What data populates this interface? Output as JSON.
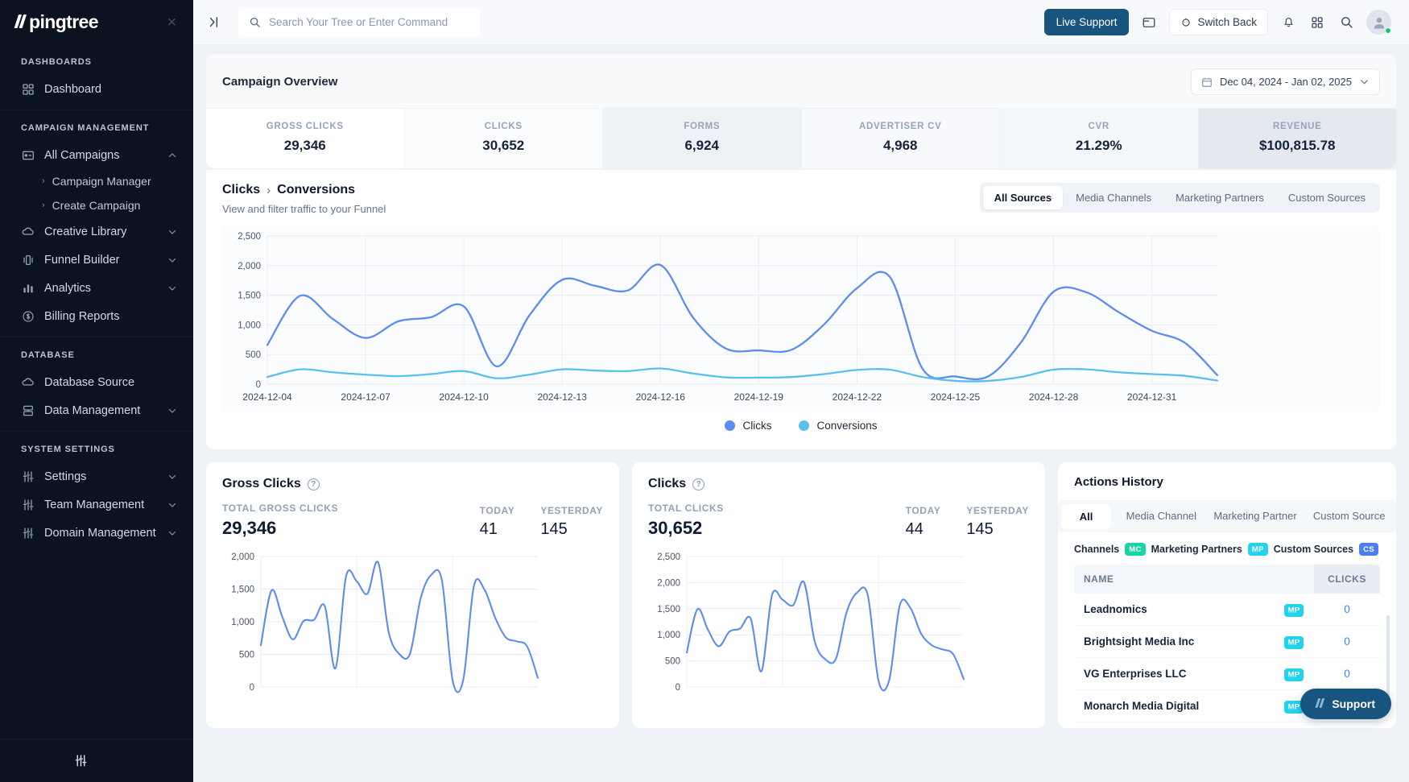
{
  "sidebar": {
    "logo": "pingtree",
    "close_icon": "close-icon",
    "sections": [
      {
        "label": "DASHBOARDS",
        "items": [
          {
            "label": "Dashboard",
            "icon": "grid-icon",
            "chevron": "",
            "subitems": []
          }
        ]
      },
      {
        "label": "CAMPAIGN MANAGEMENT",
        "items": [
          {
            "label": "All Campaigns",
            "icon": "campaign-icon",
            "chevron": "⌃",
            "subitems": [
              "Campaign Manager",
              "Create Campaign"
            ]
          },
          {
            "label": "Creative Library",
            "icon": "cloud-icon",
            "chevron": "⌄",
            "subitems": []
          },
          {
            "label": "Funnel Builder",
            "icon": "funnel-icon",
            "chevron": "⌄",
            "subitems": []
          },
          {
            "label": "Analytics",
            "icon": "bar-chart-icon",
            "chevron": "⌄",
            "subitems": []
          },
          {
            "label": "Billing Reports",
            "icon": "dollar-icon",
            "chevron": "",
            "subitems": []
          }
        ]
      },
      {
        "label": "DATABASE",
        "items": [
          {
            "label": "Database Source",
            "icon": "cloud-icon",
            "chevron": "",
            "subitems": []
          },
          {
            "label": "Data Management",
            "icon": "server-icon",
            "chevron": "⌄",
            "subitems": []
          }
        ]
      },
      {
        "label": "SYSTEM SETTINGS",
        "items": [
          {
            "label": "Settings",
            "icon": "sliders-icon",
            "chevron": "⌄",
            "subitems": []
          },
          {
            "label": "Team Management",
            "icon": "sliders-icon",
            "chevron": "⌄",
            "subitems": []
          },
          {
            "label": "Domain Management",
            "icon": "sliders-icon",
            "chevron": "⌄",
            "subitems": []
          }
        ]
      }
    ],
    "footer_icon": "sliders-icon"
  },
  "topbar": {
    "collapse_icon": "collapse-panel-icon",
    "search_placeholder": "Search Your Tree or Enter Command",
    "search_value": "",
    "live_support_label": "Live Support",
    "folder_icon": "folder-icon",
    "switch_back_label": "Switch Back",
    "bell_icon": "bell-icon",
    "apps_icon": "apps-grid-icon",
    "search_icon": "search-icon",
    "avatar_icon": "avatar"
  },
  "overview": {
    "title": "Campaign Overview",
    "date_range": "Dec 04, 2024 - Jan 02, 2025",
    "calendar_icon": "calendar-icon",
    "chevron_icon": "chevron-down-icon",
    "metrics": [
      {
        "label": "GROSS CLICKS",
        "value": "29,346"
      },
      {
        "label": "CLICKS",
        "value": "30,652"
      },
      {
        "label": "FORMS",
        "value": "6,924"
      },
      {
        "label": "ADVERTISER CV",
        "value": "4,968"
      },
      {
        "label": "CVR",
        "value": "21.29%"
      },
      {
        "label": "REVENUE",
        "value": "$100,815.78"
      }
    ]
  },
  "funnel": {
    "breadcrumb_first": "Clicks",
    "breadcrumb_sep": "›",
    "breadcrumb_second": "Conversions",
    "subtitle": "View and filter traffic to your Funnel",
    "tabs": [
      {
        "label": "All Sources",
        "active": true
      },
      {
        "label": "Media Channels",
        "active": false
      },
      {
        "label": "Marketing Partners",
        "active": false
      },
      {
        "label": "Custom Sources",
        "active": false
      }
    ]
  },
  "chart_data": [
    {
      "id": "funnel-main",
      "type": "line",
      "title": "Clicks › Conversions",
      "xlabel": "",
      "ylabel": "",
      "ylim": [
        0,
        2500
      ],
      "yticks": [
        0,
        500,
        1000,
        1500,
        2000,
        2500
      ],
      "ytick_labels": [
        "0",
        "500",
        "1,000",
        "1,500",
        "2,000",
        "2,500"
      ],
      "xticks": [
        "2024-12-04",
        "2024-12-07",
        "2024-12-10",
        "2024-12-13",
        "2024-12-16",
        "2024-12-19",
        "2024-12-22",
        "2024-12-25",
        "2024-12-28",
        "2024-12-31"
      ],
      "x": [
        "2024-12-04",
        "2024-12-05",
        "2024-12-06",
        "2024-12-07",
        "2024-12-08",
        "2024-12-09",
        "2024-12-10",
        "2024-12-11",
        "2024-12-12",
        "2024-12-13",
        "2024-12-14",
        "2024-12-15",
        "2024-12-16",
        "2024-12-17",
        "2024-12-18",
        "2024-12-19",
        "2024-12-20",
        "2024-12-21",
        "2024-12-22",
        "2024-12-23",
        "2024-12-24",
        "2024-12-25",
        "2024-12-26",
        "2024-12-27",
        "2024-12-28",
        "2024-12-29",
        "2024-12-30",
        "2024-12-31",
        "2025-01-01",
        "2025-01-02"
      ],
      "grid": true,
      "legend_position": "bottom",
      "series": [
        {
          "name": "Clicks",
          "color": "#5b8def",
          "values": [
            660,
            1490,
            1100,
            780,
            1060,
            1130,
            1310,
            300,
            1160,
            1760,
            1660,
            1580,
            2010,
            1120,
            600,
            570,
            580,
            1010,
            1620,
            1810,
            260,
            130,
            130,
            700,
            1560,
            1550,
            1210,
            900,
            700,
            150
          ]
        },
        {
          "name": "Conversions",
          "color": "#5bc0eb",
          "values": [
            120,
            250,
            200,
            160,
            135,
            170,
            220,
            100,
            160,
            250,
            230,
            220,
            265,
            180,
            115,
            110,
            120,
            170,
            240,
            245,
            120,
            55,
            55,
            120,
            245,
            250,
            200,
            170,
            140,
            60
          ]
        }
      ]
    },
    {
      "id": "gross-clicks-mini",
      "type": "line",
      "title": "Gross Clicks",
      "ylim": [
        0,
        2000
      ],
      "yticks": [
        0,
        500,
        1000,
        1500,
        2000
      ],
      "ytick_labels": [
        "0",
        "500",
        "1,000",
        "1,500",
        "2,000"
      ],
      "grid": true,
      "series": [
        {
          "name": "Gross Clicks",
          "color": "#5b8def",
          "values": [
            640,
            1480,
            1080,
            730,
            1010,
            1030,
            1240,
            285,
            1700,
            1620,
            1430,
            1910,
            840,
            505,
            510,
            1360,
            1720,
            1630,
            100,
            110,
            1550,
            1490,
            1060,
            760,
            700,
            620,
            140
          ]
        }
      ]
    },
    {
      "id": "clicks-mini",
      "type": "line",
      "title": "Clicks",
      "ylim": [
        0,
        2500
      ],
      "yticks": [
        0,
        500,
        1000,
        1500,
        2000,
        2500
      ],
      "ytick_labels": [
        "0",
        "500",
        "1,000",
        "1,500",
        "2,000",
        "2,500"
      ],
      "grid": true,
      "series": [
        {
          "name": "Clicks",
          "color": "#5b8def",
          "values": [
            660,
            1490,
            1090,
            780,
            1060,
            1120,
            1310,
            300,
            1760,
            1670,
            1570,
            2010,
            880,
            530,
            540,
            1430,
            1810,
            1750,
            120,
            130,
            1570,
            1510,
            1020,
            800,
            720,
            630,
            150
          ]
        }
      ]
    }
  ],
  "gross_clicks_card": {
    "title": "Gross Clicks",
    "help_icon": "help-circle-icon",
    "total_label": "TOTAL GROSS CLICKS",
    "total_value": "29,346",
    "today_label": "TODAY",
    "today_value": "41",
    "yesterday_label": "YESTERDAY",
    "yesterday_value": "145"
  },
  "clicks_card": {
    "title": "Clicks",
    "help_icon": "help-circle-icon",
    "total_label": "TOTAL CLICKS",
    "total_value": "30,652",
    "today_label": "TODAY",
    "today_value": "44",
    "yesterday_label": "YESTERDAY",
    "yesterday_value": "145"
  },
  "actions_history": {
    "title": "Actions History",
    "tabs": [
      {
        "label": "All",
        "active": true
      },
      {
        "label": "Media Channel",
        "active": false
      },
      {
        "label": "Marketing Partner",
        "active": false
      },
      {
        "label": "Custom Source",
        "active": false
      }
    ],
    "legend": [
      {
        "label": "Channels",
        "chip": "MC",
        "color": "#15d6a4"
      },
      {
        "label": "Marketing Partners",
        "chip": "MP",
        "color": "#22d3ee"
      },
      {
        "label": "Custom Sources",
        "chip": "CS",
        "color": "#4f7df3"
      }
    ],
    "columns": [
      "NAME",
      "CLICKS"
    ],
    "rows": [
      {
        "name": "Leadnomics",
        "badge": "MP",
        "clicks": "0"
      },
      {
        "name": "Brightsight Media Inc",
        "badge": "MP",
        "clicks": "0"
      },
      {
        "name": "VG Enterprises LLC",
        "badge": "MP",
        "clicks": "0"
      },
      {
        "name": "Monarch Media Digital",
        "badge": "MP",
        "clicks": "0"
      }
    ]
  },
  "support_fab": {
    "label": "Support"
  },
  "colors": {
    "accent": "#17557e",
    "clicks_line": "#5b8def",
    "conversions_line": "#5bc0eb",
    "sidebar_bg": "#0b1220",
    "page_bg": "#eef1f6"
  }
}
